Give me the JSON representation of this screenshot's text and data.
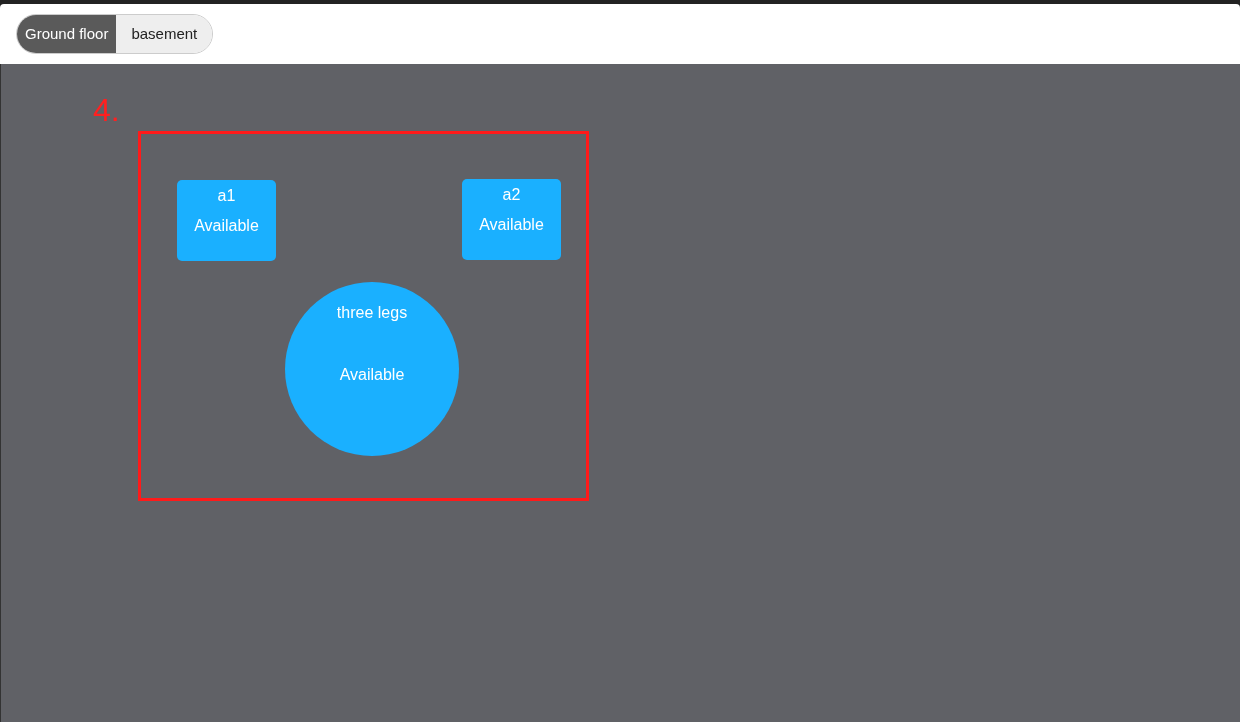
{
  "floor_tabs": [
    {
      "label": "Ground floor",
      "selected": true
    },
    {
      "label": "basement",
      "selected": false
    }
  ],
  "canvas": {
    "zone_label": "4.",
    "tables": [
      {
        "kind": "square",
        "name": "a1",
        "status": "Available"
      },
      {
        "kind": "square",
        "name": "a2",
        "status": "Available"
      },
      {
        "kind": "round",
        "name": "three legs",
        "status": "Available"
      }
    ]
  }
}
